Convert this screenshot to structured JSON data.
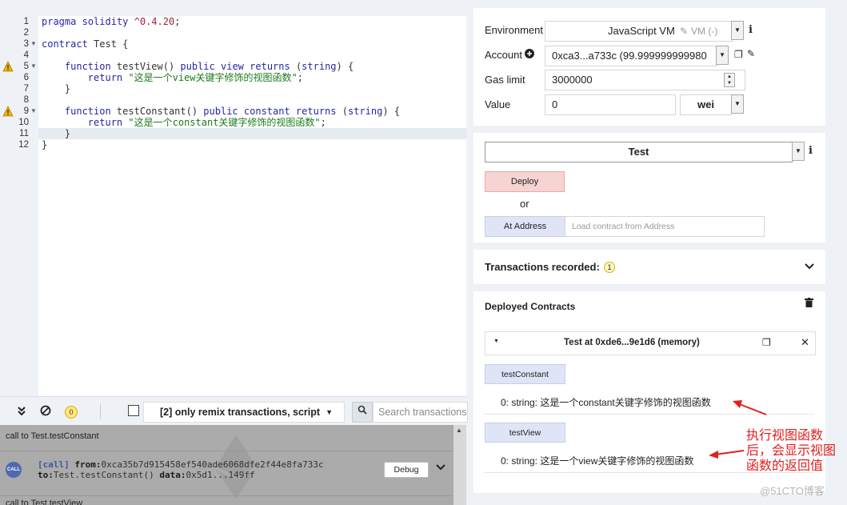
{
  "editor": {
    "lines": [
      {
        "n": "1",
        "text": "pragma solidity ^0.4.20;"
      },
      {
        "n": "2",
        "text": ""
      },
      {
        "n": "3",
        "text": "contract Test {"
      },
      {
        "n": "4",
        "text": ""
      },
      {
        "n": "5",
        "text": "    function testView() public view returns (string) {"
      },
      {
        "n": "6",
        "text": "        return \"这是一个view关键字修饰的视图函数\";"
      },
      {
        "n": "7",
        "text": "    }"
      },
      {
        "n": "8",
        "text": ""
      },
      {
        "n": "9",
        "text": "    function testConstant() public constant returns (string) {"
      },
      {
        "n": "10",
        "text": "        return \"这是一个constant关键字修饰的视图函数\";"
      },
      {
        "n": "11",
        "text": "    }"
      },
      {
        "n": "12",
        "text": "}"
      }
    ]
  },
  "terminal_bar": {
    "pending_count": "0",
    "filter_label": "[2] only remix transactions, script",
    "search_placeholder": "Search transactions"
  },
  "terminal": {
    "line1": "call to Test.testConstant",
    "call_tag": "[call]",
    "from_label": "from:",
    "from_value": "0xca35b7d915458ef540ade6068dfe2f44e8fa733c",
    "to_label": "to:",
    "to_value": "Test.testConstant()",
    "data_label": "data:",
    "data_value": "0x5d1...149ff",
    "debug_label": "Debug",
    "line2": "call to Test.testView",
    "call_icon_text": "CALL"
  },
  "run": {
    "environment_label": "Environment",
    "environment_value": "JavaScript VM",
    "environment_vm": "VM (-)",
    "account_label": "Account",
    "account_value": "0xca3...a733c (99.999999999980",
    "gas_limit_label": "Gas limit",
    "gas_limit_value": "3000000",
    "value_label": "Value",
    "value_value": "0",
    "value_unit": "wei"
  },
  "contract": {
    "selected": "Test",
    "deploy_label": "Deploy",
    "or_label": "or",
    "at_address_label": "At Address",
    "address_placeholder": "Load contract from Address"
  },
  "transactions": {
    "label": "Transactions recorded:",
    "count": "1"
  },
  "deployed": {
    "title": "Deployed Contracts",
    "instance_title": "Test at 0xde6...9e1d6 (memory)",
    "functions": [
      {
        "name": "testConstant",
        "result": "0: string: 这是一个constant关键字修饰的视图函数"
      },
      {
        "name": "testView",
        "result": "0: string: 这是一个view关键字修饰的视图函数"
      }
    ]
  },
  "annotation": {
    "lines": [
      "执行视图函数",
      "后，会显示视图",
      "函数的返回值"
    ],
    "color": "#e02020"
  },
  "watermark": "@51CTO博客",
  "colors": {
    "deploy_bg": "#f7d4d4",
    "call_bg": "#dfe5f6",
    "terminal_bg": "#ababab"
  }
}
